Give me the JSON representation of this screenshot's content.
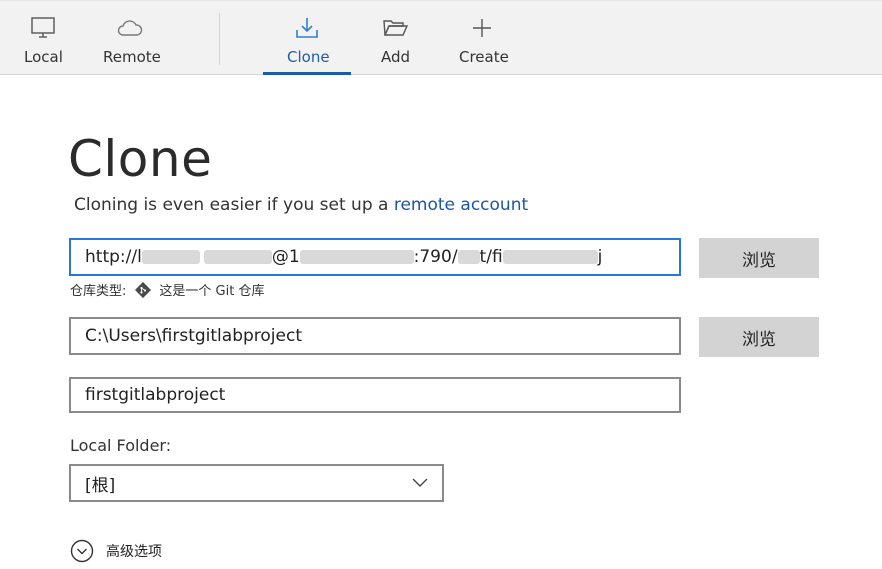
{
  "toolbar": {
    "items": [
      {
        "id": "local",
        "label": "Local",
        "icon": "monitor-icon"
      },
      {
        "id": "remote",
        "label": "Remote",
        "icon": "cloud-icon"
      },
      {
        "id": "clone",
        "label": "Clone",
        "icon": "download-icon",
        "active": true
      },
      {
        "id": "add",
        "label": "Add",
        "icon": "folder-open-icon"
      },
      {
        "id": "create",
        "label": "Create",
        "icon": "plus-icon"
      }
    ]
  },
  "page": {
    "title": "Clone",
    "subtitle_prefix": "Cloning is even easier if you set up a",
    "subtitle_link": "remote account"
  },
  "form": {
    "url": {
      "part1": "http://l",
      "part2": "@1",
      "part3": ":790/",
      "part4": "t/fi",
      "part5": "j"
    },
    "browse_label": "浏览",
    "repo_type_label": "仓库类型:",
    "repo_type_value": "这是一个 Git 仓库",
    "destination_path": "C:\\Users\\firstgitlabproject",
    "name": "firstgitlabproject",
    "local_folder_label": "Local Folder:",
    "local_folder_value": "[根]",
    "advanced_label": "高级选项"
  },
  "colors": {
    "accent": "#1b5ea8",
    "link": "#1a56a5",
    "focus_border": "#2677d9",
    "button_bg": "#d3d3d3"
  }
}
